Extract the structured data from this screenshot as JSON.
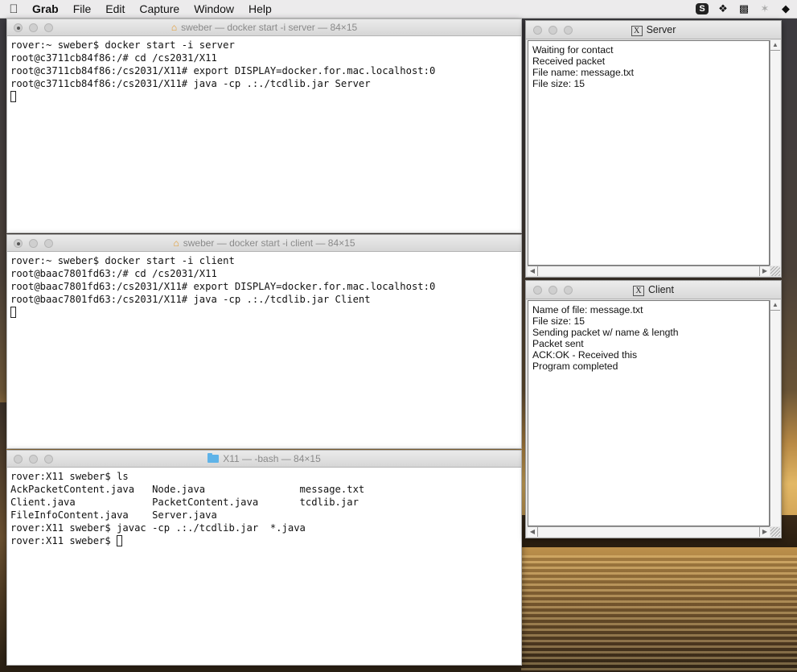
{
  "menubar": {
    "apple": "",
    "app_name": "Grab",
    "items": [
      "File",
      "Edit",
      "Capture",
      "Window",
      "Help"
    ],
    "status_icons": [
      "skype-icon",
      "dropbox-icon",
      "docker-icon",
      "bluetooth-icon",
      "wifi-icon"
    ]
  },
  "server_terminal": {
    "title": "sweber — docker start -i server — 84×15",
    "lines": [
      "rover:~ sweber$ docker start -i server",
      "root@c3711cb84f86:/# cd /cs2031/X11",
      "root@c3711cb84f86:/cs2031/X11# export DISPLAY=docker.for.mac.localhost:0",
      "root@c3711cb84f86:/cs2031/X11# java -cp .:./tcdlib.jar Server"
    ]
  },
  "client_terminal": {
    "title": "sweber — docker start -i client — 84×15",
    "lines": [
      "rover:~ sweber$ docker start -i client",
      "root@baac7801fd63:/# cd /cs2031/X11",
      "root@baac7801fd63:/cs2031/X11# export DISPLAY=docker.for.mac.localhost:0",
      "root@baac7801fd63:/cs2031/X11# java -cp .:./tcdlib.jar Client"
    ]
  },
  "bash_terminal": {
    "title": "X11 — -bash — 84×15",
    "lines": [
      "rover:X11 sweber$ ls",
      "AckPacketContent.java   Node.java                message.txt",
      "Client.java             PacketContent.java       tcdlib.jar",
      "FileInfoContent.java    Server.java",
      "rover:X11 sweber$ javac -cp .:./tcdlib.jar  *.java",
      "rover:X11 sweber$ "
    ]
  },
  "server_window": {
    "title": "Server",
    "text": "Waiting for contact\nReceived packet\nFile name: message.txt\nFile size: 15"
  },
  "client_window": {
    "title": "Client",
    "text": "Name of file: message.txt\nFile size: 15\nSending packet w/ name & length\nPacket sent\nACK:OK - Received this\nProgram completed"
  }
}
